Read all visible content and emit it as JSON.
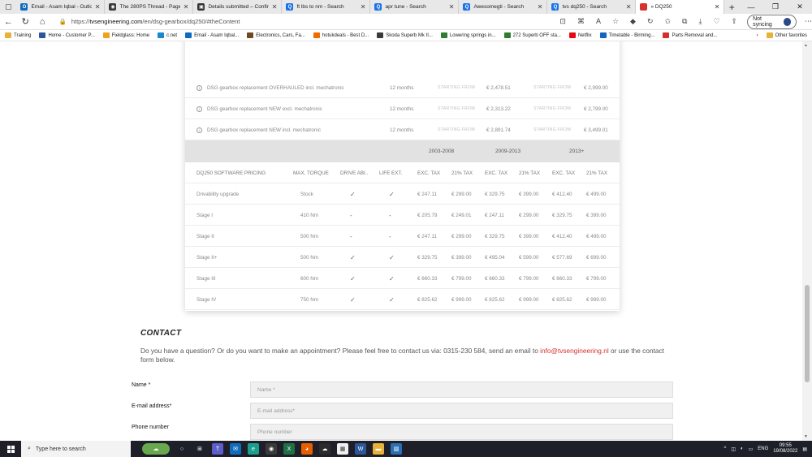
{
  "browser": {
    "tabs": [
      {
        "label": "Email - Asam Iqbal - Outlo",
        "color": "#0f6cbd",
        "glyph": "O"
      },
      {
        "label": "The 280PS Thread - Page",
        "color": "#3a3a3a",
        "glyph": "◉"
      },
      {
        "label": "Details submitted – Confir",
        "color": "#333333",
        "glyph": "▣"
      },
      {
        "label": "ft lbs to nm - Search",
        "color": "#1a73e8",
        "glyph": "Q"
      },
      {
        "label": "apr tune - Search",
        "color": "#1a73e8",
        "glyph": "Q"
      },
      {
        "label": "Awesomegti - Search",
        "color": "#1a73e8",
        "glyph": "Q"
      },
      {
        "label": "tvs dq250 - Search",
        "color": "#1a73e8",
        "glyph": "Q"
      },
      {
        "label": "» DQ250",
        "color": "#d8322f",
        "glyph": ""
      }
    ],
    "url_prefix": "https://",
    "url_host": "tvsengineering.com",
    "url_path": "/en/dsg-gearbox/dq250/#theContent",
    "sync_label": "Not syncing",
    "bookmarks": [
      {
        "label": "Training",
        "color": "#e8b23a"
      },
      {
        "label": "Home - Customer P...",
        "color": "#2b579a"
      },
      {
        "label": "Fieldglass: Home",
        "color": "#f0a21c"
      },
      {
        "label": "c.net",
        "color": "#1c86d1"
      },
      {
        "label": "Email - Asam Iqbal...",
        "color": "#0f6cbd"
      },
      {
        "label": "Electronics, Cars, Fa...",
        "color": "#6b4b1f"
      },
      {
        "label": "hotukdeals - Best D...",
        "color": "#ef6c00"
      },
      {
        "label": "Skoda Superb Mk II...",
        "color": "#3a3a3a"
      },
      {
        "label": "Lowering springs in...",
        "color": "#2e7d32"
      },
      {
        "label": "272 Superb OFF sta...",
        "color": "#2e7d32"
      },
      {
        "label": "Netflix",
        "color": "#e50914"
      },
      {
        "label": "Timetable - Birming...",
        "color": "#1565c0"
      },
      {
        "label": "Parts Removal and...",
        "color": "#d32f2f"
      }
    ],
    "other_favorites": "Other favorites"
  },
  "gearbox_rows": [
    {
      "name": "DSG gearbox replacement OVERHAULED incl. mechatronic",
      "warranty": "12 months",
      "label": "STARTING FROM",
      "price1": "€ 2,478.51",
      "price2": "€ 2,999.00"
    },
    {
      "name": "DSG gearbox replacement NEW excl. mechatronic",
      "warranty": "12 months",
      "label": "STARTING FROM",
      "price1": "€ 2,313.22",
      "price2": "€ 2,799.00"
    },
    {
      "name": "DSG gearbox replacement NEW incl. mechatronic",
      "warranty": "12 months",
      "label": "STARTING FROM",
      "price1": "€ 2,891.74",
      "price2": "€ 3,499.01"
    }
  ],
  "year_ranges": [
    "2003-2008",
    "2009-2013",
    "2013+"
  ],
  "software_table": {
    "headers": [
      "DQ250 SOFTWARE PRICING",
      "MAX. TORQUE",
      "DRIVE ABI..",
      "LIFE EXT.",
      "EXC. TAX",
      "21% TAX",
      "EXC. TAX",
      "21% TAX",
      "EXC. TAX",
      "21% TAX"
    ],
    "rows": [
      {
        "name": "Drivability upgrade",
        "torque": "Stock",
        "drive": "✓",
        "life": "✓",
        "p": [
          "€ 247.11",
          "€ 299.00",
          "€ 329.75",
          "€ 399.00",
          "€ 412.40",
          "€ 499.00"
        ]
      },
      {
        "name": "Stage I",
        "torque": "410 Nm",
        "drive": "-",
        "life": "-",
        "p": [
          "€ 205.79",
          "€ 249.01",
          "€ 247.11",
          "€ 299.00",
          "€ 329.75",
          "€ 399.00"
        ]
      },
      {
        "name": "Stage II",
        "torque": "500 Nm",
        "drive": "-",
        "life": "-",
        "p": [
          "€ 247.11",
          "€ 299.00",
          "€ 329.75",
          "€ 399.00",
          "€ 412.40",
          "€ 499.00"
        ]
      },
      {
        "name": "Stage II+",
        "torque": "500 Nm",
        "drive": "✓",
        "life": "✓",
        "p": [
          "€ 329.75",
          "€ 399.00",
          "€ 495.04",
          "€ 599.00",
          "€ 577.69",
          "€ 699.00"
        ]
      },
      {
        "name": "Stage III",
        "torque": "600 Nm",
        "drive": "✓",
        "life": "✓",
        "p": [
          "€ 660.33",
          "€ 799.00",
          "€ 660.33",
          "€ 799.00",
          "€ 660.33",
          "€ 799.00"
        ]
      },
      {
        "name": "Stage IV",
        "torque": "750 Nm",
        "drive": "✓",
        "life": "✓",
        "p": [
          "€ 825.62",
          "€ 999.00",
          "€ 825.62",
          "€ 999.00",
          "€ 825.62",
          "€ 999.00"
        ]
      }
    ]
  },
  "contact": {
    "title": "CONTACT",
    "text_before": "Do you have a question? Or do you want to make an appointment? Please feel free to contact us via: 0315-230 584, send an email to ",
    "email": "info@tvsengineering.nl",
    "text_after": " or use the contact form below.",
    "fields": [
      {
        "label": "Name *",
        "placeholder": "Name *"
      },
      {
        "label": "E-mail address*",
        "placeholder": "E-mail address*"
      },
      {
        "label": "Phone number",
        "placeholder": "Phone number"
      }
    ]
  },
  "taskbar": {
    "search_placeholder": "Type here to search",
    "lang": "ENG",
    "time": "09:55",
    "date": "19/08/2022"
  }
}
